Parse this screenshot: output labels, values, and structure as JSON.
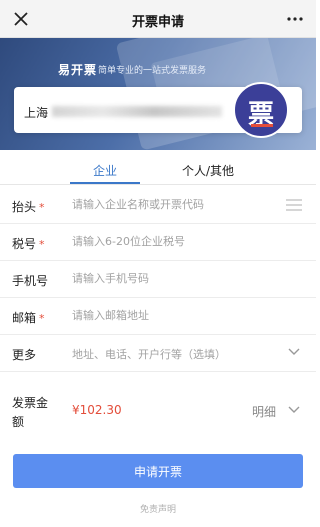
{
  "header": {
    "title": "开票申请",
    "close_icon": "close-icon",
    "more_icon": "more-dots-icon"
  },
  "banner": {
    "brand": "易开票",
    "slogan": "简单专业的一站式发票服务"
  },
  "company": {
    "name_prefix": "上海",
    "logo_glyph": "票"
  },
  "tabs": [
    {
      "label": "企业",
      "active": true
    },
    {
      "label": "个人/其他",
      "active": false
    }
  ],
  "form": {
    "title": {
      "label": "抬头",
      "required": "*",
      "placeholder": "请输入企业名称或开票代码"
    },
    "tax_id": {
      "label": "税号",
      "required": "*",
      "placeholder": "请输入6-20位企业税号"
    },
    "phone": {
      "label": "手机号",
      "placeholder": "请输入手机号码"
    },
    "email": {
      "label": "邮箱",
      "required": "*",
      "placeholder": "请输入邮箱地址"
    },
    "more": {
      "label": "更多",
      "placeholder": "地址、电话、开户行等（选填）"
    }
  },
  "amount": {
    "label": "发票金额",
    "value": "¥102.30",
    "detail_label": "明细"
  },
  "submit_label": "申请开票",
  "disclaimer": "免责声明",
  "colors": {
    "accent": "#3b78c9",
    "button": "#5b8ef0",
    "required": "#e34d3a",
    "logo_bg": "#3b3f98"
  }
}
